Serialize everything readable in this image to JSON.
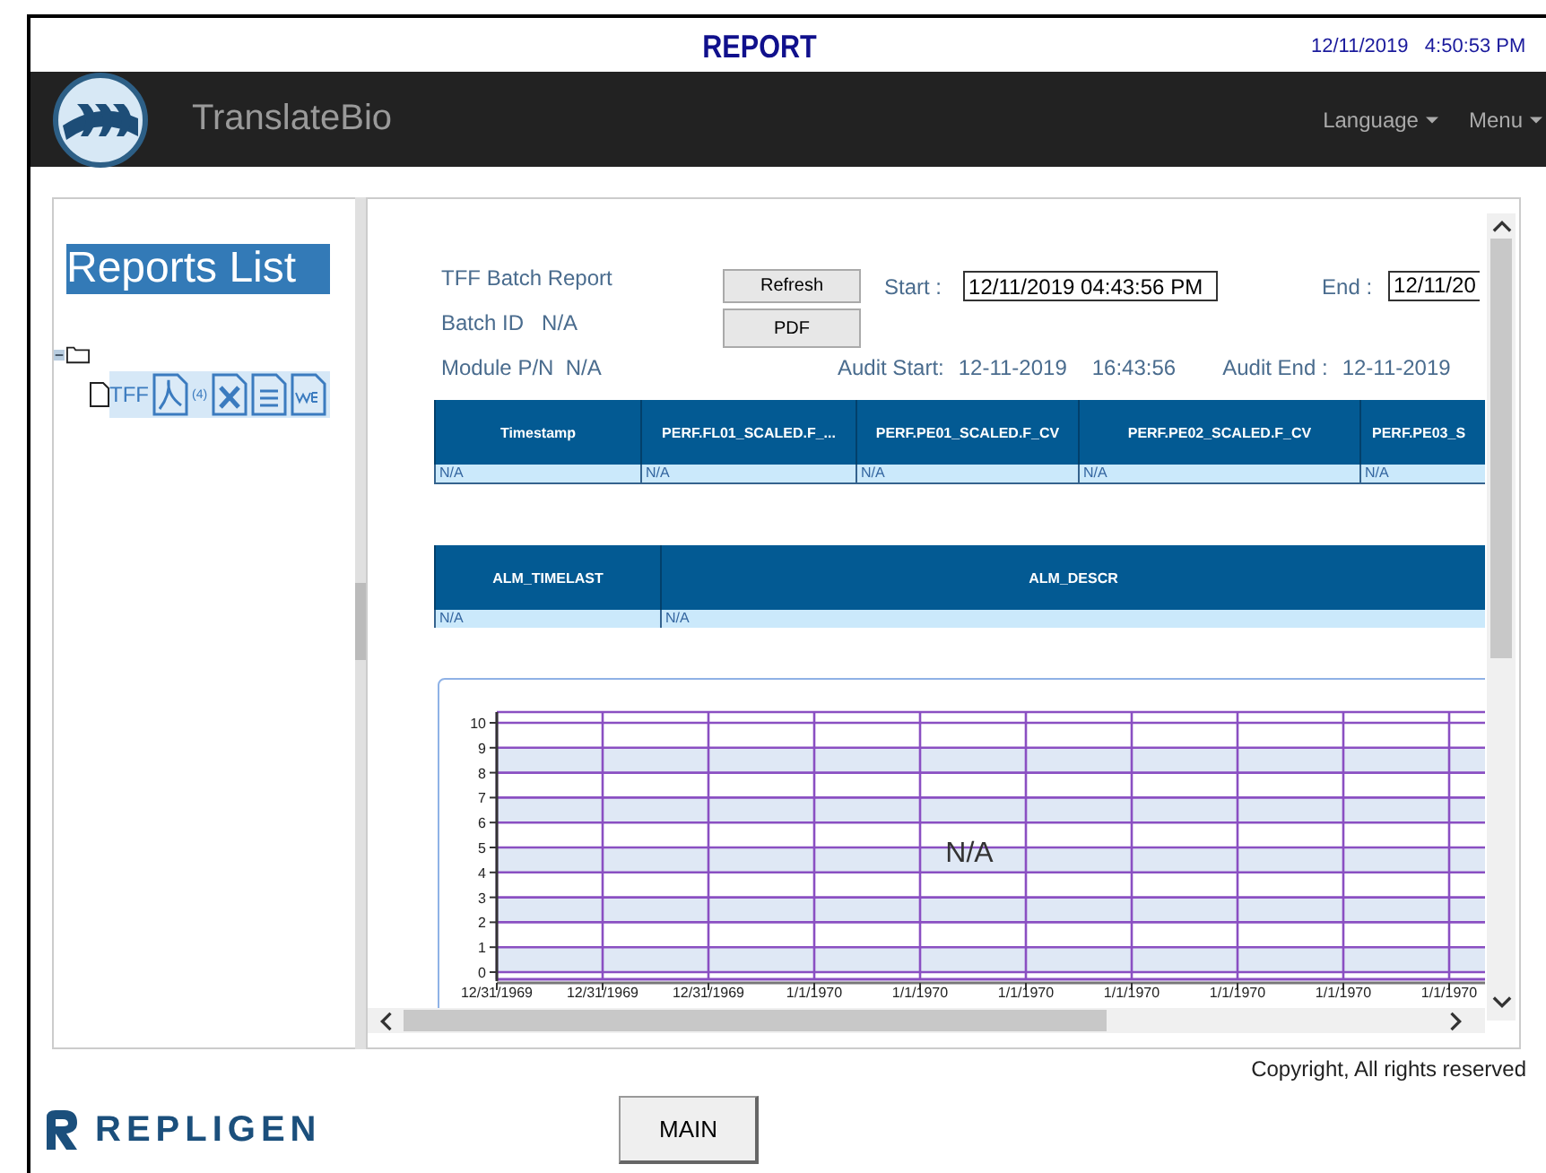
{
  "header": {
    "title": "REPORT",
    "date": "12/11/2019",
    "time": "4:50:53 PM"
  },
  "navbar": {
    "brand": "TranslateBio",
    "menus": [
      {
        "label": "Language"
      },
      {
        "label": "Menu"
      }
    ]
  },
  "sidebar": {
    "heading": "Reports List",
    "tree": [
      {
        "expanded": true,
        "children": [
          {
            "label": "TFF",
            "count": "(4)"
          }
        ]
      }
    ]
  },
  "report": {
    "title": "TFF Batch Report",
    "batch_id": {
      "label": "Batch ID",
      "value": "N/A"
    },
    "module_pn": {
      "label": "Module P/N",
      "value": "N/A"
    },
    "buttons": [
      "Refresh",
      "PDF"
    ],
    "start": {
      "label": "Start :",
      "value": "12/11/2019 04:43:56 PM"
    },
    "end": {
      "label": "End :",
      "value": "12/11/20"
    },
    "audit_start": {
      "label": "Audit Start:",
      "date": "12-11-2019",
      "time": "16:43:56"
    },
    "audit_end": {
      "label": "Audit End :",
      "date": "12-11-2019"
    }
  },
  "data_table": {
    "columns": [
      "Timestamp",
      "PERF.FL01_SCALED.F_...",
      "PERF.PE01_SCALED.F_CV",
      "PERF.PE02_SCALED.F_CV",
      "PERF.PE03_S"
    ],
    "rows": [
      [
        "N/A",
        "N/A",
        "N/A",
        "N/A",
        "N/A"
      ]
    ]
  },
  "alarm_table": {
    "columns": [
      "ALM_TIMELAST",
      "ALM_DESCR"
    ],
    "rows": [
      [
        "N/A",
        "N/A"
      ]
    ]
  },
  "chart": {
    "no_data_text": "N/A",
    "chart_data": {
      "type": "line",
      "grid": true,
      "categories": [
        "12/31/1969",
        "12/31/1969",
        "12/31/1969",
        "1/1/1970",
        "1/1/1970",
        "1/1/1970",
        "1/1/1970",
        "1/1/1970",
        "1/1/1970",
        "1/1/1970"
      ],
      "ylim": [
        0,
        10
      ],
      "yticks": [
        0,
        1,
        2,
        3,
        4,
        5,
        6,
        7,
        8,
        9,
        10
      ]
    }
  },
  "footer": {
    "copyright": "Copyright, All rights reserved",
    "logo": "REPLIGEN",
    "button": "MAIN"
  }
}
